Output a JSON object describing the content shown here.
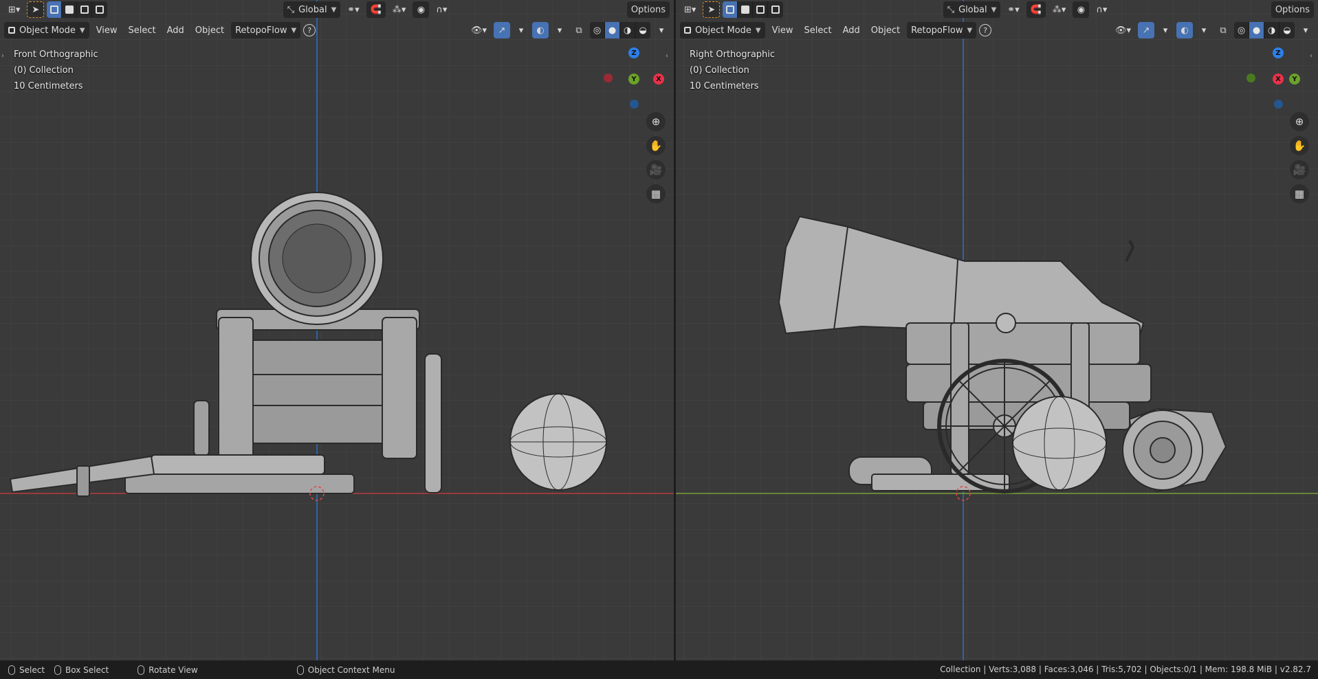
{
  "header": {
    "transform_orientation": "Global",
    "options_label": "Options",
    "mode_label": "Object Mode",
    "menus": [
      "View",
      "Select",
      "Add",
      "Object",
      "RetopoFlow"
    ]
  },
  "viewports": {
    "left": {
      "view_name": "Front Orthographic",
      "collection": "(0) Collection",
      "scale": "10 Centimeters",
      "gizmo": {
        "top": "Z",
        "center": "Y",
        "right": "X"
      }
    },
    "right": {
      "view_name": "Right Orthographic",
      "collection": "(0) Collection",
      "scale": "10 Centimeters",
      "gizmo": {
        "top": "Z",
        "center": "X",
        "right": "Y"
      }
    }
  },
  "status": {
    "select": "Select",
    "box_select": "Box Select",
    "rotate_view": "Rotate View",
    "context_menu": "Object Context Menu",
    "stats": "Collection | Verts:3,088 | Faces:3,046 | Tris:5,702 | Objects:0/1 | Mem: 198.8 MiB | v2.82.7"
  },
  "icons": [
    "editor-type-icon",
    "select-tool-icon",
    "transform-icon",
    "snap-icon",
    "proportional-icon",
    "view-icon",
    "gizmo-icon",
    "overlay-icon",
    "xray-icon",
    "shading-wireframe-icon",
    "shading-solid-icon",
    "shading-material-icon",
    "shading-rendered-icon",
    "zoom-icon",
    "hand-icon",
    "camera-icon",
    "grid-icon"
  ],
  "colors": {
    "x_axis": "#e8324a",
    "y_axis": "#6ba22a",
    "z_axis": "#2d7fe8",
    "active": "#4772b3"
  }
}
